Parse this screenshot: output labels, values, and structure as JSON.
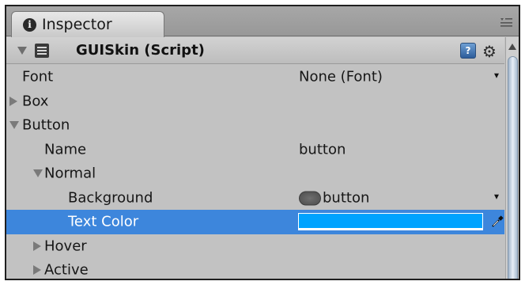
{
  "tab": {
    "label": "Inspector",
    "icon": "info-icon"
  },
  "component": {
    "title": "GUISkin (Script)",
    "help_glyph": "?",
    "gear_glyph": "⚙"
  },
  "rows": [
    {
      "label": "Font",
      "value": "None (Font)",
      "indent": 0,
      "foldout": "none"
    },
    {
      "label": "Box",
      "value": "",
      "indent": 0,
      "foldout": "collapsed"
    },
    {
      "label": "Button",
      "value": "",
      "indent": 0,
      "foldout": "expanded"
    },
    {
      "label": "Name",
      "value": "button",
      "indent": 1,
      "foldout": "none"
    },
    {
      "label": "Normal",
      "value": "",
      "indent": 1,
      "foldout": "expanded"
    },
    {
      "label": "Background",
      "value": "button",
      "indent": 2,
      "foldout": "none"
    },
    {
      "label": "Text Color",
      "value": "",
      "indent": 2,
      "foldout": "none"
    },
    {
      "label": "Hover",
      "value": "",
      "indent": 1,
      "foldout": "collapsed"
    },
    {
      "label": "Active",
      "value": "",
      "indent": 1,
      "foldout": "collapsed"
    }
  ],
  "colors": {
    "selection": "#3d86dc",
    "text_color_swatch": "#00a3ff"
  }
}
